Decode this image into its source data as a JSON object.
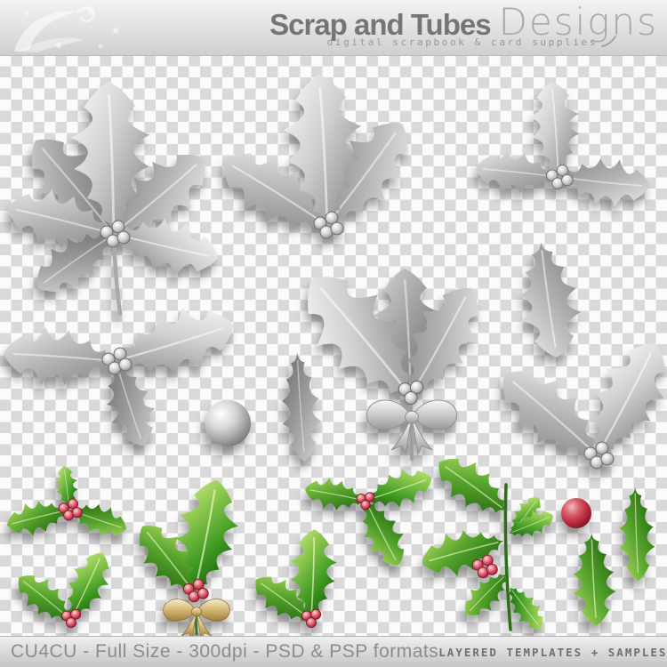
{
  "header": {
    "brand_bold": "Scrap and Tubes",
    "brand_light": "Designs",
    "tagline": "digital scrapbook & card supplies"
  },
  "footer": {
    "left_label": "CU4CU - Full Size - 300dpi - PSD & PSP formats",
    "right_label": "LAYERED TEMPLATES + SAMPLES"
  },
  "palette": {
    "checker_light": "#fbfbfb",
    "checker_dark": "#d9d9d9",
    "bar_gradient_top": "#f0f0f0",
    "bar_gradient_bottom": "#c9c9c9",
    "brand_bold_color": "#757575",
    "brand_light_color": "#a9a9a9",
    "tagline_color": "#979797",
    "footer_text_color": "#8c8c8c",
    "footer_mono_color": "#6f6f6f",
    "silver_leaf": "#b2b2b2",
    "green_leaf": "#4d9e2a",
    "berry_red": "#c22b44",
    "gold_bow": "#cfae62"
  },
  "artwork": {
    "templates": [
      "silver-holly-cluster-large",
      "silver-holly-cluster-top-center",
      "silver-holly-cluster-top-right",
      "silver-holly-leaf-single",
      "silver-holly-cluster-mid-left",
      "silver-berry-ball",
      "silver-holly-leaf-narrow",
      "silver-holly-cluster-with-bow",
      "silver-holly-cluster-mid-right"
    ],
    "samples": [
      "green-holly-sprig-1",
      "green-holly-sprig-2",
      "green-holly-sprig-gold-bow",
      "green-holly-sprig-3",
      "green-holly-sprig-4",
      "green-holly-branch",
      "red-berry-ball",
      "green-leaf-single-1",
      "green-leaf-single-2"
    ]
  }
}
